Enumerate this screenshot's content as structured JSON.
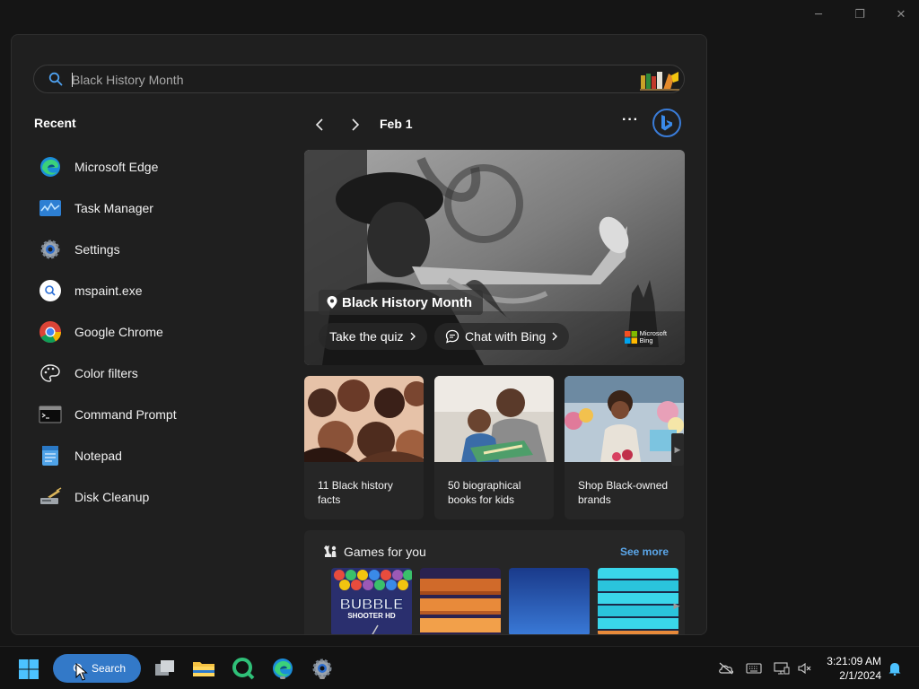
{
  "window_controls": {
    "minimize": "─",
    "restore": "❐",
    "close": "✕"
  },
  "search": {
    "placeholder": "Black History Month",
    "value": ""
  },
  "recent": {
    "title": "Recent",
    "items": [
      {
        "label": "Microsoft Edge",
        "icon": "edge-icon"
      },
      {
        "label": "Task Manager",
        "icon": "task-manager-icon"
      },
      {
        "label": "Settings",
        "icon": "settings-gear-icon"
      },
      {
        "label": "mspaint.exe",
        "icon": "search-result-icon"
      },
      {
        "label": "Google Chrome",
        "icon": "chrome-icon"
      },
      {
        "label": "Color filters",
        "icon": "palette-icon"
      },
      {
        "label": "Command Prompt",
        "icon": "command-prompt-icon"
      },
      {
        "label": "Notepad",
        "icon": "notepad-icon"
      },
      {
        "label": "Disk Cleanup",
        "icon": "disk-cleanup-icon"
      }
    ]
  },
  "highlights": {
    "date": "Feb 1",
    "more": "···",
    "hero": {
      "tag": "Black History Month",
      "quiz_button": "Take the quiz",
      "chat_button": "Chat with Bing",
      "brand_line1": "Microsoft",
      "brand_line2": "Bing"
    },
    "cards": [
      {
        "text": "11 Black history facts"
      },
      {
        "text": "50 biographical books for kids"
      },
      {
        "text": "Shop Black-owned brands"
      }
    ],
    "games": {
      "title": "Games for you",
      "see_more": "See more",
      "tile1_line1": "BUBBLE",
      "tile1_line2": "SHOOTER HD"
    }
  },
  "taskbar": {
    "search_label": "Search",
    "time": "3:21:09 AM",
    "date": "2/1/2024"
  },
  "colors": {
    "accent": "#3379c8",
    "link": "#5ba7ea",
    "panel_bg": "#1f1f1f",
    "card_bg": "#262626"
  }
}
